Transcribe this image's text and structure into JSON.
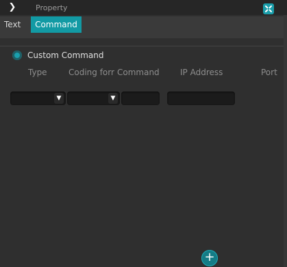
{
  "header": {
    "title": "Property"
  },
  "tabs": [
    {
      "label": "Text",
      "active": false
    },
    {
      "label": "Command",
      "active": true
    }
  ],
  "custom_command": {
    "label": "Custom Command",
    "selected": true
  },
  "columns": [
    "Type",
    "Coding forr",
    "Command",
    "IP Address",
    "Port"
  ],
  "row": {
    "type_value": "",
    "coding_value": "",
    "command_value": "",
    "ip_value": ""
  },
  "icons": {
    "expand": "chevron-right-icon",
    "close": "close-pin-icon",
    "add": "plus-icon",
    "dropdown": "caret-down-icon"
  },
  "colors": {
    "accent": "#129aa4",
    "panel": "#2f2f2f",
    "field": "#1b1b1b"
  }
}
